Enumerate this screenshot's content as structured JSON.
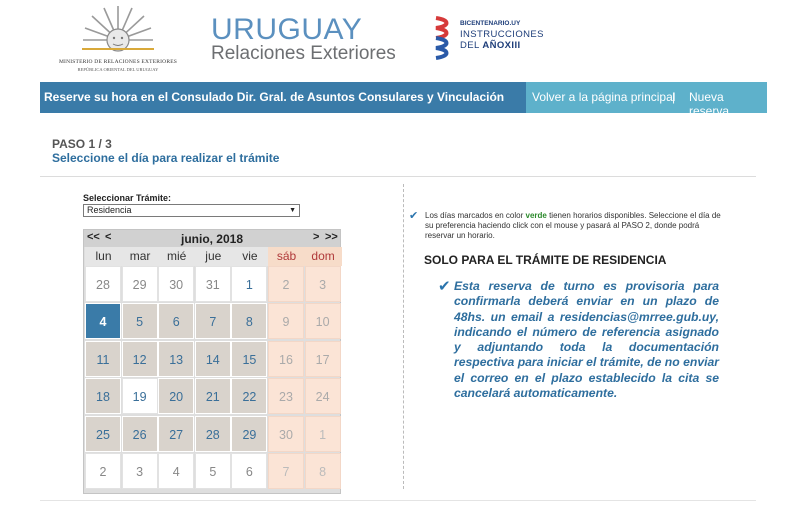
{
  "header": {
    "ministry_line1": "MINISTERIO DE RELACIONES EXTERIORES",
    "ministry_line2": "REPÚBLICA ORIENTAL DEL URUGUAY",
    "title_main": "URUGUAY",
    "title_sub": "Relaciones Exteriores",
    "bicentenario_line1": "BICENTENARIO.UY",
    "bicentenario_line2": "INSTRUCCIONES",
    "bicentenario_line3a": "DEL ",
    "bicentenario_line3b": "AÑOXIII"
  },
  "navbar": {
    "title": "Reserve su hora en el Consulado Dir. Gral. de Asuntos Consulares y Vinculación",
    "back_link": "Volver a la página principal",
    "separator": "|",
    "new_link": "Nueva reserva"
  },
  "step": {
    "number": "PASO 1 / 3",
    "description": "Seleccione el día para realizar el trámite"
  },
  "tramite": {
    "label": "Seleccionar Trámite:",
    "selected": "Residencia"
  },
  "calendar": {
    "prev_year": "<<",
    "prev_month": "<",
    "month_label": "junio, 2018",
    "next_month": ">",
    "next_year": ">>",
    "weekdays": [
      "lun",
      "mar",
      "mié",
      "jue",
      "vie",
      "sáb",
      "dom"
    ],
    "weeks": [
      [
        {
          "d": "28",
          "t": "out"
        },
        {
          "d": "29",
          "t": "out"
        },
        {
          "d": "30",
          "t": "out"
        },
        {
          "d": "31",
          "t": "out"
        },
        {
          "d": "1",
          "t": "white"
        },
        {
          "d": "2",
          "t": "we"
        },
        {
          "d": "3",
          "t": "we"
        }
      ],
      [
        {
          "d": "4",
          "t": "sel"
        },
        {
          "d": "5",
          "t": "avail"
        },
        {
          "d": "6",
          "t": "avail"
        },
        {
          "d": "7",
          "t": "avail"
        },
        {
          "d": "8",
          "t": "avail"
        },
        {
          "d": "9",
          "t": "we"
        },
        {
          "d": "10",
          "t": "we"
        }
      ],
      [
        {
          "d": "11",
          "t": "avail"
        },
        {
          "d": "12",
          "t": "avail"
        },
        {
          "d": "13",
          "t": "avail"
        },
        {
          "d": "14",
          "t": "avail"
        },
        {
          "d": "15",
          "t": "avail"
        },
        {
          "d": "16",
          "t": "we"
        },
        {
          "d": "17",
          "t": "we"
        }
      ],
      [
        {
          "d": "18",
          "t": "avail"
        },
        {
          "d": "19",
          "t": "white"
        },
        {
          "d": "20",
          "t": "avail"
        },
        {
          "d": "21",
          "t": "avail"
        },
        {
          "d": "22",
          "t": "avail"
        },
        {
          "d": "23",
          "t": "we"
        },
        {
          "d": "24",
          "t": "we"
        }
      ],
      [
        {
          "d": "25",
          "t": "avail"
        },
        {
          "d": "26",
          "t": "avail"
        },
        {
          "d": "27",
          "t": "avail"
        },
        {
          "d": "28",
          "t": "avail"
        },
        {
          "d": "29",
          "t": "avail"
        },
        {
          "d": "30",
          "t": "we"
        },
        {
          "d": "1",
          "t": "weout"
        }
      ],
      [
        {
          "d": "2",
          "t": "out"
        },
        {
          "d": "3",
          "t": "out"
        },
        {
          "d": "4",
          "t": "out"
        },
        {
          "d": "5",
          "t": "out"
        },
        {
          "d": "6",
          "t": "out"
        },
        {
          "d": "7",
          "t": "weout"
        },
        {
          "d": "8",
          "t": "weout"
        }
      ]
    ]
  },
  "info": {
    "text_before": "Los días marcados en color ",
    "text_green": "verde",
    "text_after": " tienen horarios disponibles. Seleccione el día de su preferencia haciendo click con el mouse y pasará al PASO 2, donde podrá reservar un horario."
  },
  "solo": {
    "title": "SOLO PARA EL TRÁMITE DE RESIDENCIA",
    "notice": "Esta reserva de turno es provisoria para confirmarla deberá enviar en un plazo de 48hs. un email a residencias@mrree.gub.uy, indicando el número de referencia asignado y adjuntando toda la documentación respectiva para iniciar el trámite, de no enviar el correo en el plazo establecido la cita se cancelará automaticamente."
  },
  "colors": {
    "brand_blue": "#3a7ba8",
    "nav_light": "#5eb1cb",
    "available_day": "#d9d3cc",
    "weekend_day": "#fbe4d6",
    "notice_text": "#2e6e9e"
  },
  "icons": {
    "check": "check-icon",
    "sun": "sun-of-may-icon",
    "bicentenario": "bicentenario-ribbon-icon"
  }
}
